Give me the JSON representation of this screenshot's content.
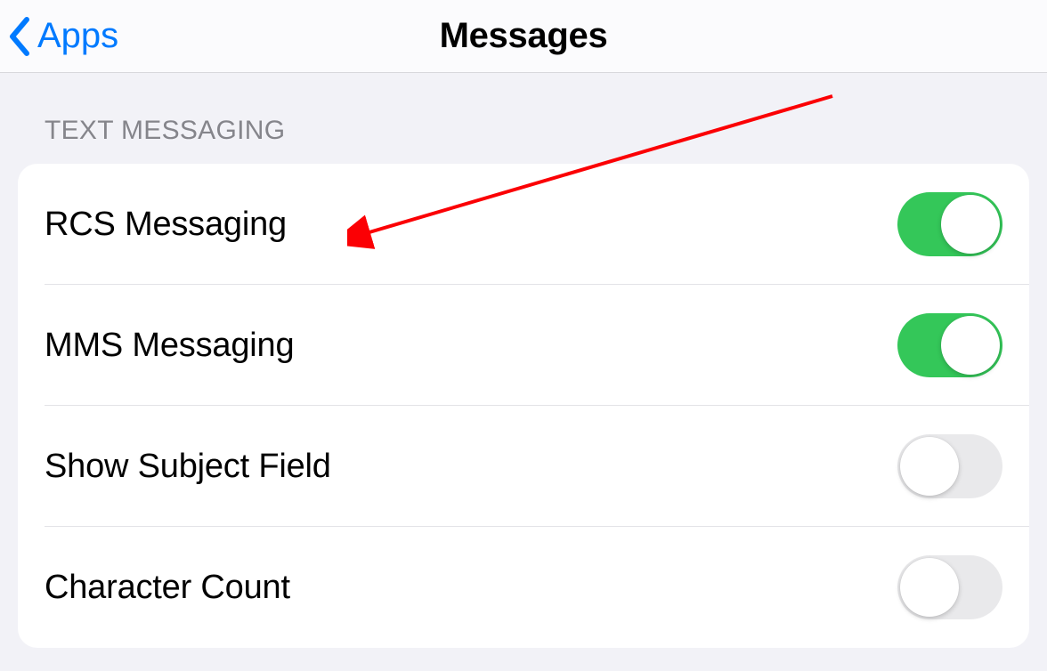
{
  "header": {
    "back_label": "Apps",
    "title": "Messages"
  },
  "section": {
    "header": "TEXT MESSAGING",
    "rows": [
      {
        "label": "RCS Messaging",
        "on": true
      },
      {
        "label": "MMS Messaging",
        "on": true
      },
      {
        "label": "Show Subject Field",
        "on": false
      },
      {
        "label": "Character Count",
        "on": false
      }
    ]
  },
  "colors": {
    "accent": "#007aff",
    "toggle_on": "#34c759",
    "toggle_off": "#e9e9eb",
    "annotation": "#fb0004"
  }
}
